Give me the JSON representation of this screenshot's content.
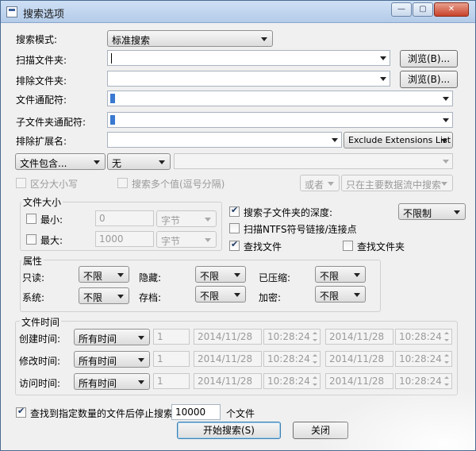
{
  "window": {
    "title": "搜索选项",
    "buttons": {
      "minimize": "—",
      "maximize": "▢",
      "close": "✕"
    }
  },
  "search_mode": {
    "label": "搜索模式:",
    "value": "标准搜索"
  },
  "scan_folder": {
    "label": "扫描文件夹:",
    "value": "",
    "browse": "浏览(B)..."
  },
  "exclude_folder": {
    "label": "排除文件夹:",
    "value": "",
    "browse": "浏览(B)..."
  },
  "file_wildcard": {
    "label": "文件通配符:",
    "value": ""
  },
  "subfolder_wildcard": {
    "label": "子文件夹通配符:",
    "value": ""
  },
  "exclude_ext": {
    "label": "排除扩展名:",
    "value": "",
    "list": "Exclude Extensions List"
  },
  "content": {
    "mode": "文件包含...",
    "encoding": "无",
    "text": ""
  },
  "options": {
    "case_sensitive": "区分大小写",
    "multi_values": "搜索多个值(逗号分隔)",
    "logic": "或者",
    "stream": "只在主要数据流中搜索"
  },
  "file_size": {
    "title": "文件大小",
    "min_label": "最小:",
    "min_value": "0",
    "min_unit": "字节",
    "max_label": "最大:",
    "max_value": "1000",
    "max_unit": "字节"
  },
  "subfolder_depth": {
    "label": "搜索子文件夹的深度:",
    "value": "不限制"
  },
  "scan_ntfs": "扫描NTFS符号链接/连接点",
  "find_files": "查找文件",
  "find_folders": "查找文件夹",
  "attributes": {
    "title": "属性",
    "readonly_label": "只读:",
    "readonly": "不限",
    "hidden_label": "隐藏:",
    "hidden": "不限",
    "compressed_label": "已压缩:",
    "compressed": "不限",
    "system_label": "系统:",
    "system": "不限",
    "archive_label": "存档:",
    "archive": "不限",
    "encrypted_label": "加密:",
    "encrypted": "不限"
  },
  "file_time": {
    "title": "文件时间",
    "rows": [
      {
        "label": "创建时间:",
        "mode": "所有时间",
        "count": "1",
        "date1": "2014/11/28",
        "time1": "10:28:24",
        "date2": "2014/11/28",
        "time2": "10:28:24"
      },
      {
        "label": "修改时间:",
        "mode": "所有时间",
        "count": "1",
        "date1": "2014/11/28",
        "time1": "10:28:24",
        "date2": "2014/11/28",
        "time2": "10:28:24"
      },
      {
        "label": "访问时间:",
        "mode": "所有时间",
        "count": "1",
        "date1": "2014/11/28",
        "time1": "10:28:24",
        "date2": "2014/11/28",
        "time2": "10:28:24"
      }
    ]
  },
  "stop_after": {
    "label": "查找到指定数量的文件后停止搜索.",
    "value": "10000",
    "unit": "个文件"
  },
  "actions": {
    "start": "开始搜索(S)",
    "close": "关闭"
  }
}
